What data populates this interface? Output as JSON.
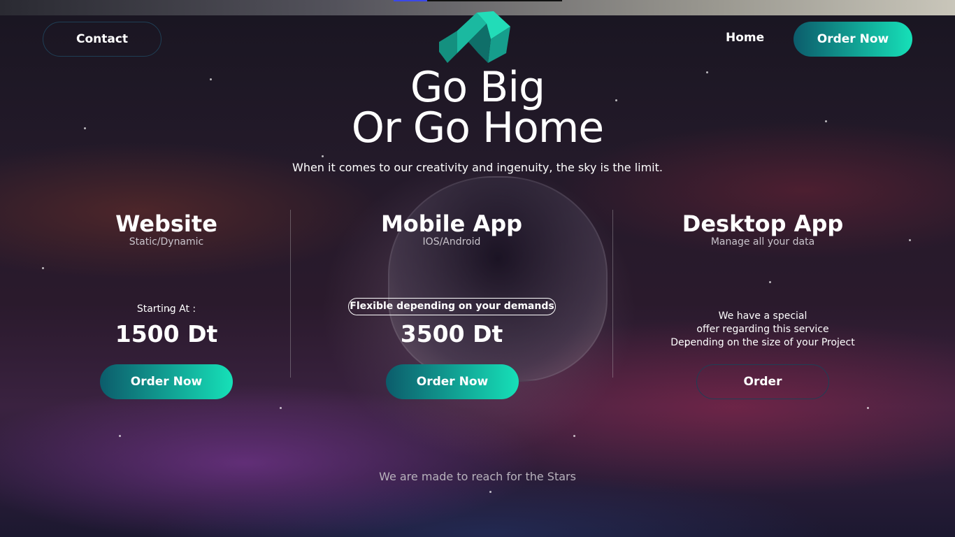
{
  "nav": {
    "contact_label": "Contact",
    "home_label": "Home",
    "order_label": "Order Now"
  },
  "hero": {
    "title_line1": "Go Big",
    "title_line2": "Or Go Home",
    "subtitle": "When it comes to our creativity and ingenuity, the sky is the limit."
  },
  "services": [
    {
      "title": "Website",
      "subtitle": "Static/Dynamic",
      "note": "Starting At :",
      "price": "1500 Dt",
      "button": "Order Now"
    },
    {
      "title": "Mobile App",
      "subtitle": "IOS/Android",
      "note": "Flexible depending on your demands",
      "price": "3500 Dt",
      "button": "Order Now"
    },
    {
      "title": "Desktop App",
      "subtitle": "Manage all your data",
      "note_lines": [
        "We have a special",
        "offer regarding this service",
        "Depending on the size of your Project"
      ],
      "button": "Order"
    }
  ],
  "footer": {
    "tagline": "We are made to reach for the Stars"
  },
  "colors": {
    "accent_start": "#0c5c6b",
    "accent_end": "#16e0b8",
    "outline": "#1f3f55"
  }
}
